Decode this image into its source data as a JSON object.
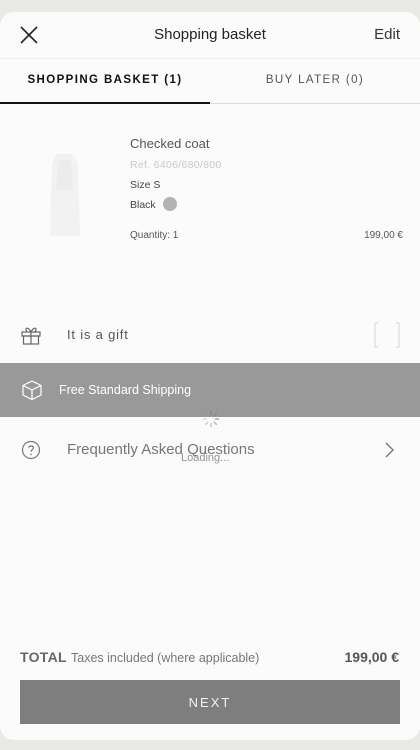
{
  "header": {
    "title": "Shopping basket",
    "edit_label": "Edit"
  },
  "tabs": [
    {
      "label": "SHOPPING BASKET (1)",
      "active": true
    },
    {
      "label": "BUY LATER (0)",
      "active": false
    }
  ],
  "product": {
    "name": "Checked coat",
    "ref": "Ref. 6406/680/800",
    "size": "Size S",
    "color_name": "Black",
    "color_swatch": "#b3b3b3",
    "quantity": "Quantity: 1",
    "price": "199,00 €"
  },
  "gift": {
    "label": "It is a gift",
    "icon": "gift-icon"
  },
  "shipping": {
    "label": "Free Standard Shipping",
    "icon": "box-icon"
  },
  "overlay": {
    "loading_text": "Loading..."
  },
  "faq": {
    "label": "Frequently Asked Questions",
    "icon": "question-circle-icon"
  },
  "summary": {
    "total_label": "TOTAL",
    "tax_note": "Taxes included (where applicable)",
    "total_price": "199,00 €"
  },
  "next_button": {
    "label": "NEXT"
  },
  "colors": {
    "shipping_bar": "#999999",
    "next_button": "#7e7e7e"
  }
}
